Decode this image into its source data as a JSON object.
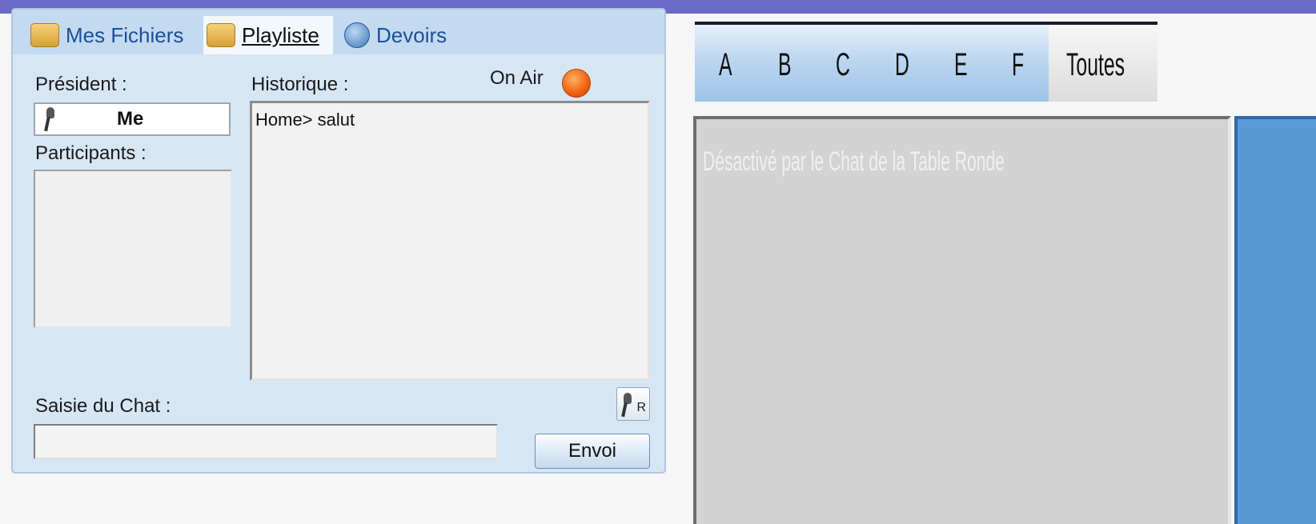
{
  "tabs": [
    {
      "label": "Mes Fichiers",
      "icon": "folder-users-icon"
    },
    {
      "label": "Playliste",
      "icon": "playlist-icon",
      "active": true
    },
    {
      "label": "Devoirs",
      "icon": "homework-icon"
    }
  ],
  "chat": {
    "president_label": "Président :",
    "president_name": "Me",
    "participants_label": "Participants :",
    "history_label": "Historique :",
    "history_text": "Home> salut",
    "on_air_label": "On Air",
    "input_label": "Saisie du Chat :",
    "input_value": "",
    "send_label": "Envoi",
    "raise_hand_label": "R"
  },
  "filter": {
    "letters": [
      "A",
      "B",
      "C",
      "D",
      "E",
      "F"
    ],
    "all_label": "Toutes"
  },
  "message_area": {
    "text": "Désactivé par le Chat de la Table Ronde"
  },
  "colors": {
    "banner": "#6a6bc8",
    "panel_bg": "#d7e6f5",
    "on_air": "#f06010",
    "disabled_area": "#d3d3d3",
    "side_strip": "#5c97d7"
  }
}
